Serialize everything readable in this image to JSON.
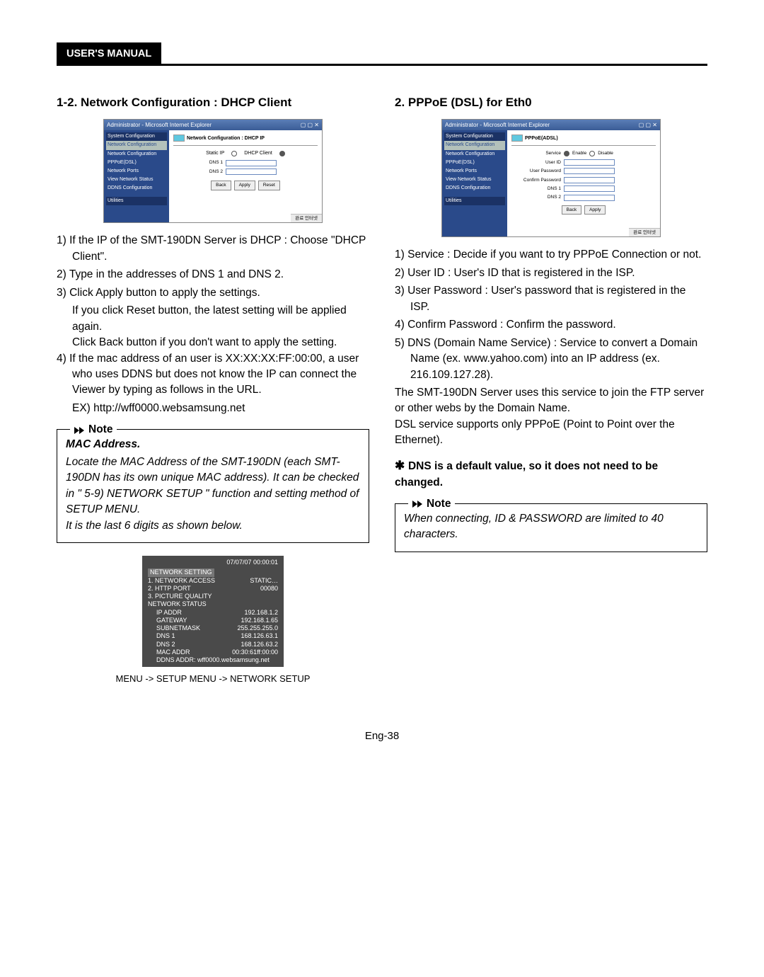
{
  "header": {
    "tab": "USER'S MANUAL"
  },
  "left": {
    "title": "1-2. Network Configuration : DHCP Client",
    "mockup": {
      "titlebar": "Administrator - Microsoft Internet Explorer",
      "panel_hdr": "Network Configuration : DHCP IP",
      "radio1": "Static IP",
      "radio2": "DHCP Client",
      "fields": [
        "DNS 1",
        "DNS 2"
      ],
      "buttons": [
        "Back",
        "Apply",
        "Reset"
      ],
      "sidebar_group1": "System Configuration",
      "sidebar_group2_hdr": "Network Configuration",
      "sidebar_items": [
        "Network Configuration",
        "PPPoE(DSL)",
        "Network Ports",
        "View Network Status",
        "DDNS Configuration"
      ],
      "sidebar_group3": "Utilities",
      "footer_icon": "완료 인터넷"
    },
    "items": [
      {
        "num": "1)",
        "text": "If the IP of the SMT-190DN Server is DHCP : Choose \"DHCP Client\"."
      },
      {
        "num": "2)",
        "text": "Type in the addresses of DNS 1 and DNS 2."
      },
      {
        "num": "3)",
        "text": "Click Apply button to apply the settings.",
        "subs": [
          "If you click Reset button, the latest setting will be applied again.",
          "Click Back button if you don't want to apply the setting."
        ]
      },
      {
        "num": "4)",
        "text": "If the mac address of an user is XX:XX:XX:FF:00:00, a user who uses DDNS but does not know the IP can connect the Viewer by typing as follows in the URL.",
        "subs": [
          "EX) http://wff0000.websamsung.net"
        ]
      }
    ],
    "note": {
      "title": "Note",
      "subtitle": "MAC Address.",
      "body": "Locate the MAC Address of the SMT-190DN (each SMT-190DN has its own unique MAC address). It can be checked in \" 5-9) NETWORK SETUP \" function and setting method of SETUP MENU.\nIt is the last 6 digits as shown below."
    },
    "osd": {
      "timestamp": "07/07/07   00:00:01",
      "section1": "NETWORK SETTING",
      "rows1": [
        [
          "1. NETWORK ACCESS",
          "STATIC…"
        ],
        [
          "2. HTTP PORT",
          "00080"
        ],
        [
          "3. PICTURE QUALITY",
          ""
        ]
      ],
      "section2": "NETWORK STATUS",
      "rows2": [
        [
          "IP   ADDR",
          "192.168.1.2"
        ],
        [
          "GATEWAY",
          "192.168.1.65"
        ],
        [
          "SUBNETMASK",
          "255.255.255.0"
        ],
        [
          "DNS 1",
          "168.126.63.1"
        ],
        [
          "DNS 2",
          "168.126.63.2"
        ],
        [
          "MAC ADDR",
          "00:30:61ff:00:00"
        ],
        [
          "DDNS ADDR: wff0000.websamsung.net",
          ""
        ]
      ]
    },
    "caption": "MENU -> SETUP MENU -> NETWORK SETUP"
  },
  "right": {
    "title": "2. PPPoE (DSL) for Eth0",
    "mockup": {
      "titlebar": "Administrator - Microsoft Internet Explorer",
      "panel_hdr": "PPPoE(ADSL)",
      "fields": [
        {
          "label": "Service",
          "radios": [
            "Enable",
            "Disable"
          ]
        },
        {
          "label": "User ID"
        },
        {
          "label": "User Password"
        },
        {
          "label": "Confirm Password"
        },
        {
          "label": "DNS 1"
        },
        {
          "label": "DNS 2"
        }
      ],
      "buttons": [
        "Back",
        "Apply"
      ],
      "sidebar_items": [
        "Network Configuration",
        "PPPoE(DSL)",
        "Network Ports",
        "View Network Status",
        "DDNS Configuration"
      ],
      "sidebar_group3": "Utilities",
      "footer_icon": "완료 인터넷"
    },
    "items": [
      {
        "num": "1)",
        "text": "Service : Decide if you want to try PPPoE Connection or not."
      },
      {
        "num": "2)",
        "text": "User ID : User's ID that is registered in the ISP."
      },
      {
        "num": "3)",
        "text": "User Password : User's password that is registered in the ISP."
      },
      {
        "num": "4)",
        "text": "Confirm Password : Confirm the password."
      },
      {
        "num": "5)",
        "text": "DNS (Domain Name Service) : Service to convert a Domain Name (ex. www.yahoo.com) into an IP address (ex. 216.109.127.28)."
      }
    ],
    "para1": "The SMT-190DN Server uses this service to join the FTP server or other webs by the Domain Name.",
    "para2": "DSL service supports only PPPoE (Point to Point over the Ethernet).",
    "bold": "DNS is a default value, so it does not need to be changed.",
    "note": {
      "title": "Note",
      "body": "When connecting, ID & PASSWORD are limited to 40 characters."
    }
  },
  "pagenum": "Eng-38"
}
